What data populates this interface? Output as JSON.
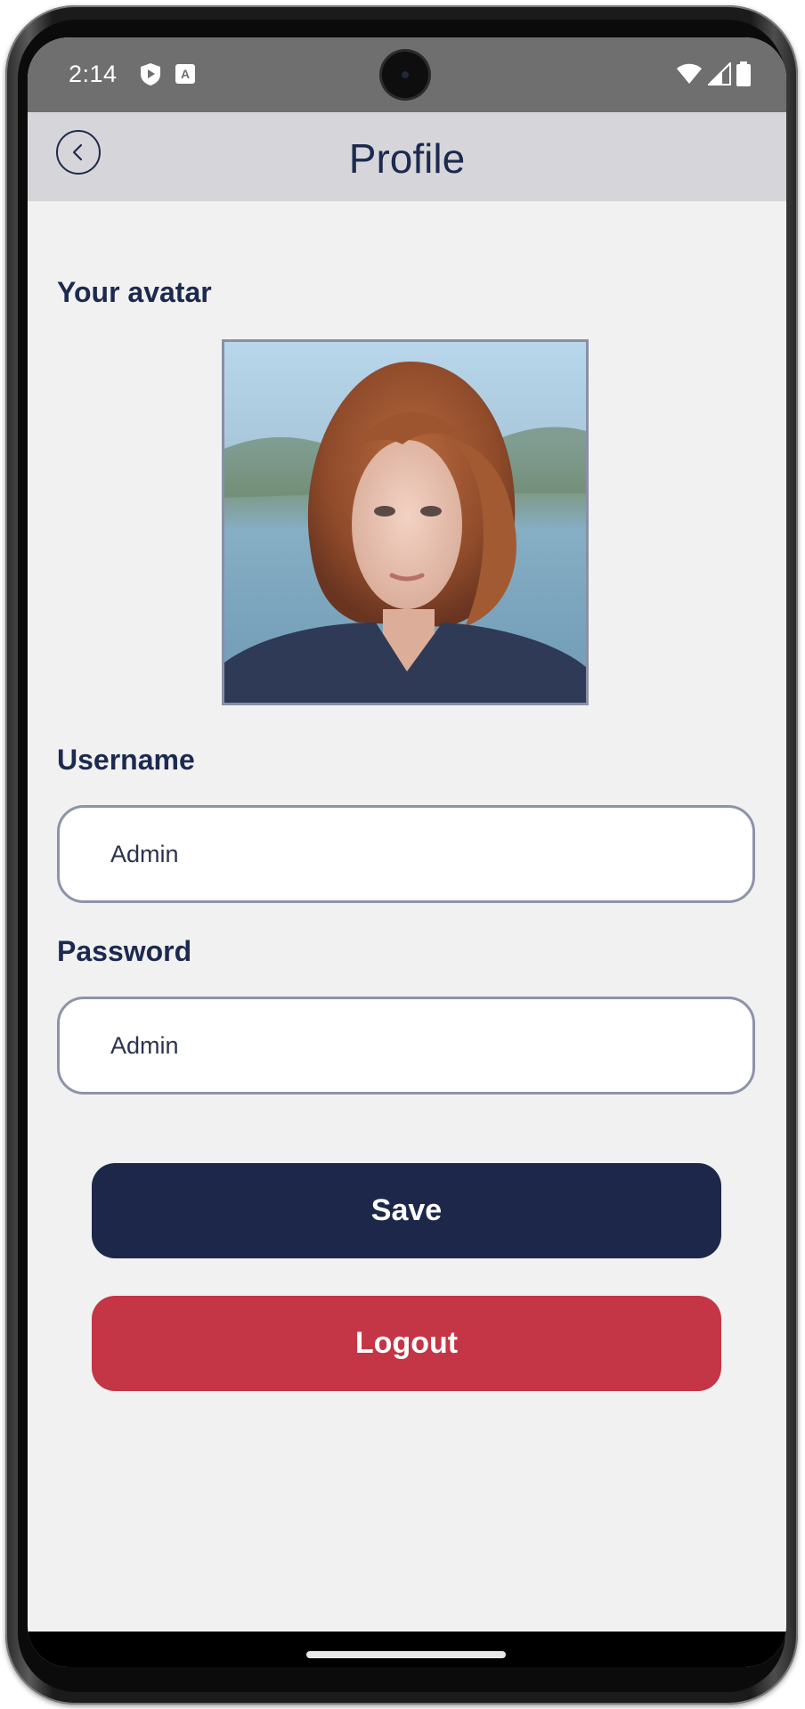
{
  "status_bar": {
    "time": "2:14",
    "icons": [
      "shield-icon",
      "translate-a-icon",
      "wifi-icon",
      "signal-icon",
      "battery-icon"
    ]
  },
  "header": {
    "title": "Profile",
    "back_icon": "chevron-left-icon"
  },
  "profile": {
    "avatar_label": "Your avatar",
    "username_label": "Username",
    "username_value": "Admin",
    "password_label": "Password",
    "password_value": "Admin"
  },
  "actions": {
    "save_label": "Save",
    "logout_label": "Logout"
  },
  "colors": {
    "primary": "#1c274a",
    "danger": "#c43545",
    "app_bar": "#d6d6da",
    "background": "#f1f1f1",
    "title_text": "#1c2a50"
  }
}
